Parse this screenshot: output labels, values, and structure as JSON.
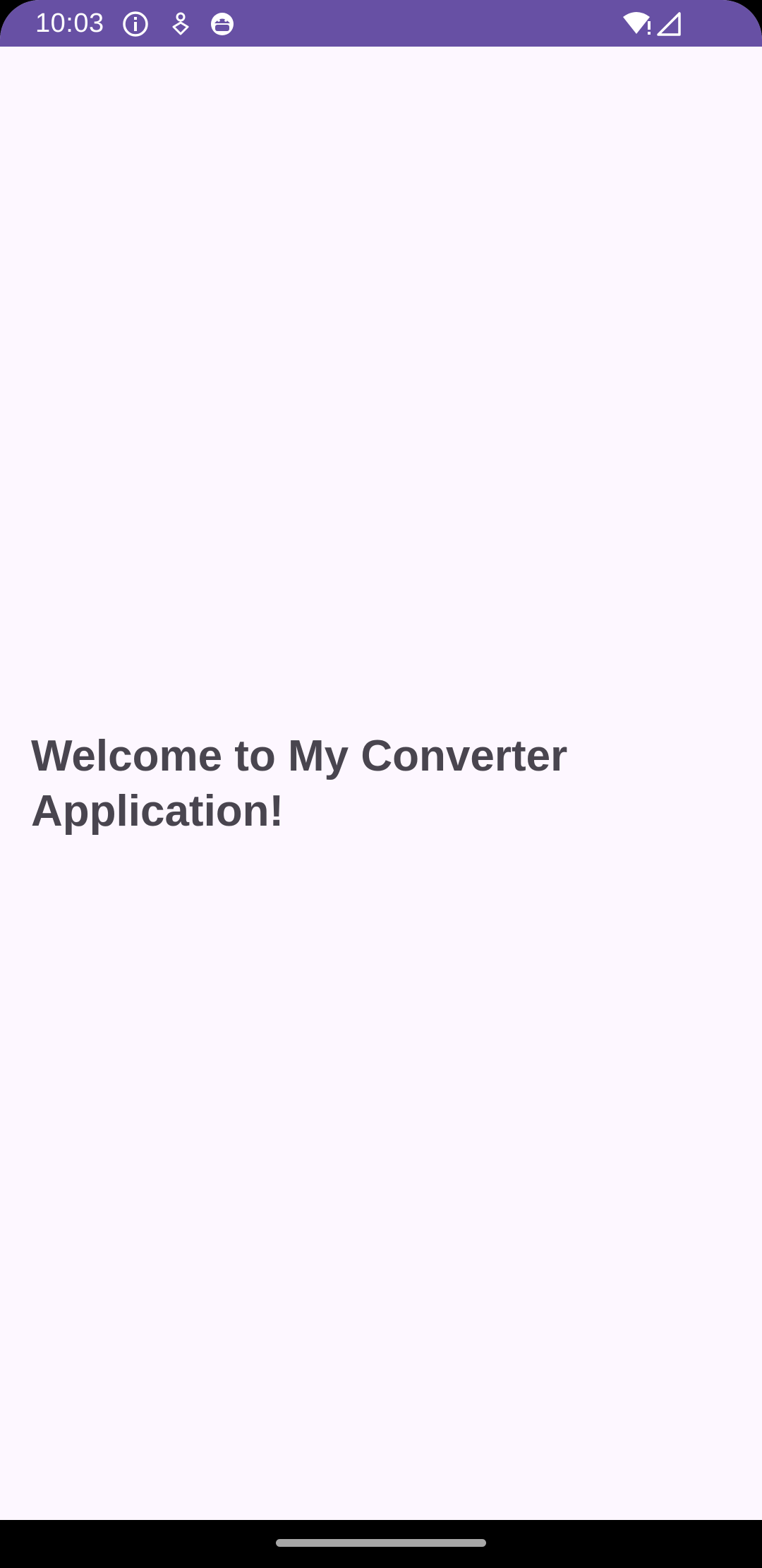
{
  "status_bar": {
    "time": "10:03",
    "color": "#6750a4",
    "left_icons": [
      "info-icon",
      "accessibility-icon",
      "android-debug-icon"
    ],
    "right_icons": [
      "wifi-no-internet-icon",
      "cell-signal-icon"
    ]
  },
  "main": {
    "welcome_text": "Welcome to My Converter Application!",
    "background_color": "#fdf7ff",
    "text_color": "#49454f"
  },
  "navigation_bar": {
    "type": "gesture",
    "handle_icon": "home-gesture-handle"
  }
}
